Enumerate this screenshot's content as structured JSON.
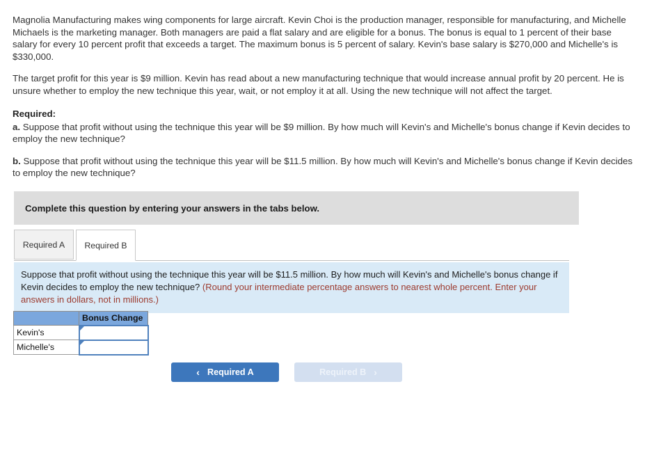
{
  "stem": {
    "paragraph_1": "Magnolia Manufacturing makes wing components for large aircraft. Kevin Choi is the production manager, responsible for manufacturing, and Michelle Michaels is the marketing manager. Both managers are paid a flat salary and are eligible for a bonus. The bonus is equal to 1 percent of their base salary for every 10 percent profit that exceeds a target. The maximum bonus is 5 percent of salary. Kevin's base salary is $270,000 and Michelle's is $330,000.",
    "paragraph_2": "The target profit for this year is $9 million. Kevin has read about a new manufacturing technique that would increase annual profit by 20 percent. He is unsure whether to employ the new technique this year, wait, or not employ it at all. Using the new technique will not affect the target."
  },
  "required": {
    "title": "Required:",
    "items": [
      {
        "letter": "a.",
        "text": " Suppose that profit without using the technique this year will be $9 million. By how much will Kevin's and Michelle's bonus change if Kevin decides to employ the new technique?"
      },
      {
        "letter": "b.",
        "text": " Suppose that profit without using the technique this year will be $11.5 million. By how much will Kevin's and Michelle's bonus change if Kevin decides to employ the new technique?"
      }
    ]
  },
  "instruction_bar": {
    "text": "Complete this question by entering your answers in the tabs below."
  },
  "tabs": [
    {
      "label": "Required A",
      "active": false
    },
    {
      "label": "Required B",
      "active": true
    }
  ],
  "question_panel": {
    "main_text": "Suppose that profit without using the technique this year will be $11.5 million. By how much will Kevin's and Michelle's bonus change if Kevin decides to employ the new technique? ",
    "hint_text": "(Round your intermediate percentage answers to nearest whole percent. Enter your answers in dollars, not in millions.)"
  },
  "answer_table": {
    "header_blank": "",
    "header_label": "Bonus Change",
    "rows": [
      {
        "label": "Kevin's",
        "value": "",
        "placeholder": ""
      },
      {
        "label": "Michelle's",
        "value": "",
        "placeholder": ""
      }
    ]
  },
  "nav": {
    "prev": {
      "label": "Required A",
      "icon": "chevron-left-icon",
      "glyph": "‹",
      "enabled": true
    },
    "next": {
      "label": "Required B",
      "icon": "chevron-right-icon",
      "glyph": "›",
      "enabled": false
    }
  },
  "colors": {
    "accent_blue": "#3d77bc",
    "panel_blue": "#d9eaf7",
    "table_header_blue": "#7ba7dd",
    "input_border_blue": "#4f81bd",
    "disabled_blue": "#d3dff0",
    "bar_gray": "#dddddd",
    "hint_red": "#9c3a2e"
  }
}
